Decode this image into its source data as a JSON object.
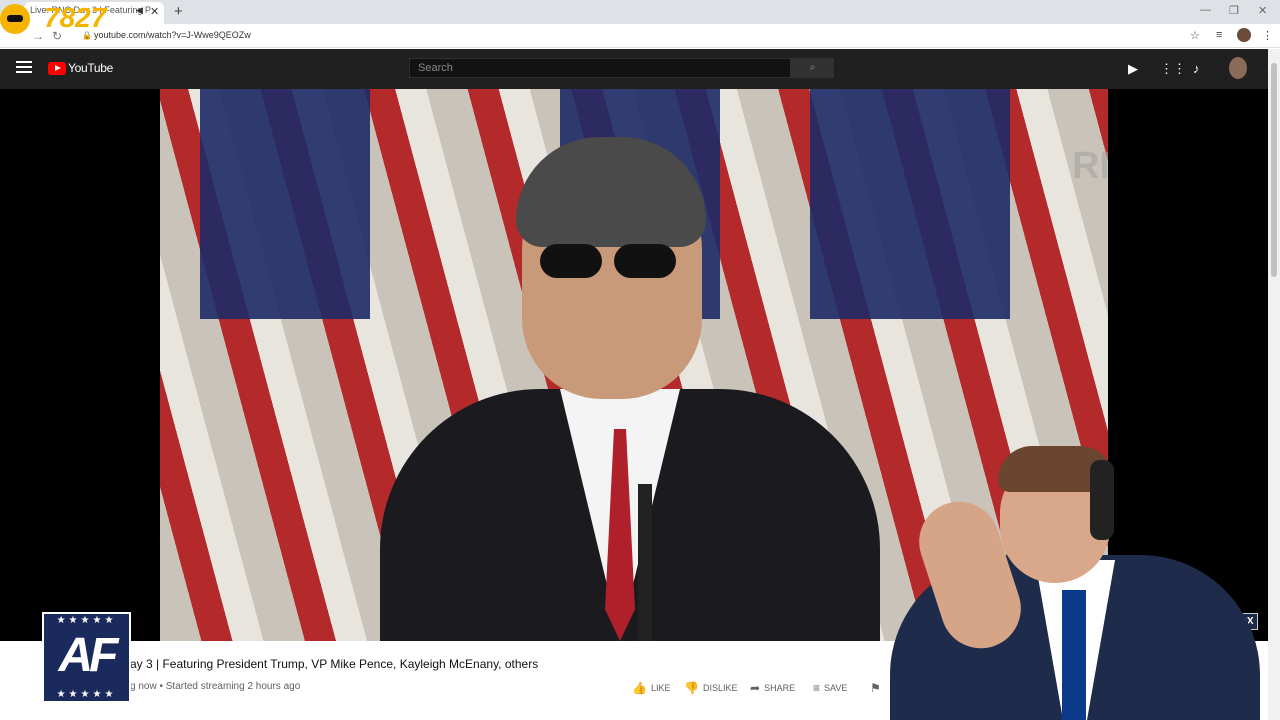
{
  "browser": {
    "tab_title": "Live: RNC Day 3 | Featuring P",
    "tab_close": "✕",
    "new_tab": "+",
    "url": "youtube.com/watch?v=J-Wwe9QEOZw",
    "window_controls": [
      "—",
      "❐",
      "✕"
    ]
  },
  "youtube": {
    "logo_text": "YouTube",
    "search_placeholder": "Search"
  },
  "video": {
    "watermark": "RNC",
    "corner_bug": "FOX"
  },
  "info": {
    "title": "ay 3 | Featuring President Trump, VP Mike Pence, Kayleigh McEnany, others",
    "meta": "g now • Started streaming 2 hours ago",
    "actions": {
      "like": "LIKE",
      "dislike": "DISLIKE",
      "share": "SHARE",
      "save": "SAVE"
    }
  },
  "overlay": {
    "viewer_count": "7827",
    "af_logo_text": "AF",
    "af_stars": "★★★★★"
  },
  "icons": [
    "menu-icon",
    "search-icon",
    "camera-icon",
    "apps-icon",
    "bell-icon",
    "like-icon",
    "dislike-icon",
    "share-icon",
    "save-icon",
    "flag-icon",
    "star-icon",
    "reload-icon",
    "back-icon",
    "forward-icon",
    "lock-icon"
  ]
}
